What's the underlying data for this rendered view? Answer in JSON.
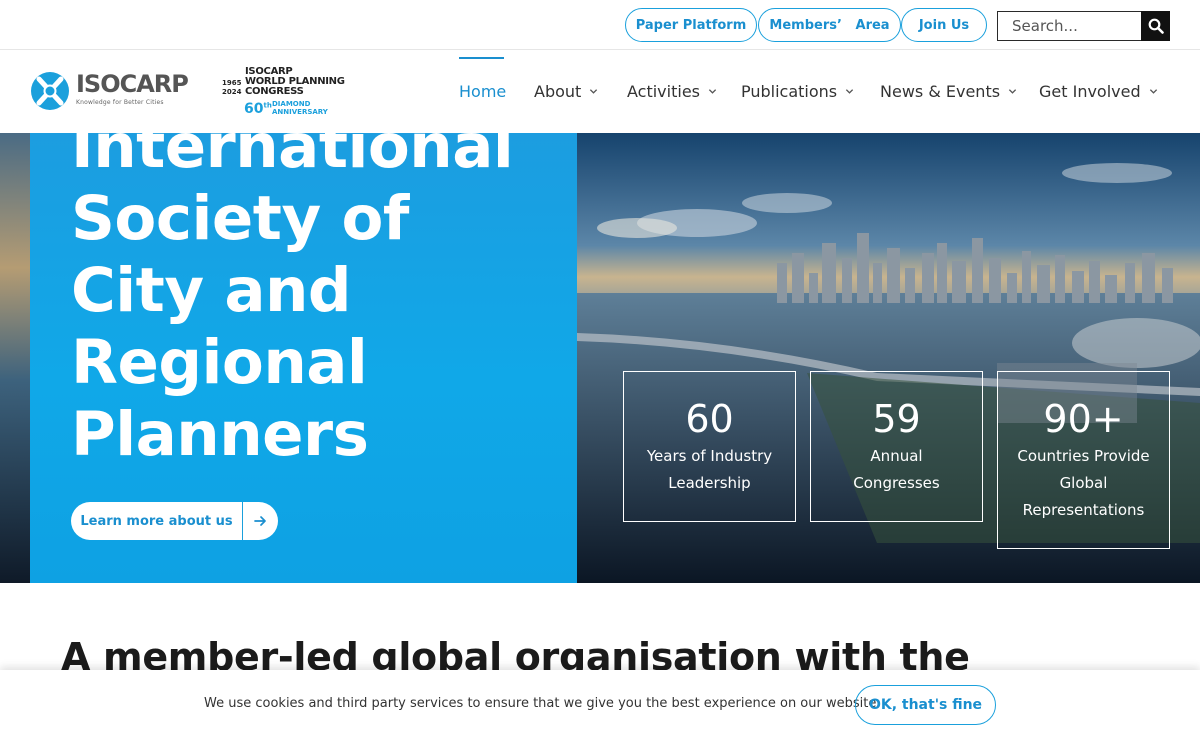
{
  "topbar": {
    "paper_platform": "Paper Platform",
    "members_area": "Members’   Area",
    "join_us": "Join Us",
    "search_placeholder": "Search..."
  },
  "logo": {
    "name": "ISOCARP",
    "tagline": "Knowledge for Better Cities"
  },
  "anniversary": {
    "year_start": "1965",
    "year_end": "2024",
    "title_line1": "ISOCARP",
    "title_line2": "WORLD PLANNING",
    "title_line3": "CONGRESS",
    "number": "60",
    "ordinal": "th",
    "sub_line1": "DIAMOND",
    "sub_line2": "ANNIVERSARY"
  },
  "nav": {
    "items": [
      {
        "label": "Home",
        "active": true
      },
      {
        "label": "About"
      },
      {
        "label": "Activities"
      },
      {
        "label": "Publications"
      },
      {
        "label": "News & Events"
      },
      {
        "label": "Get Involved"
      }
    ]
  },
  "hero": {
    "title_line1": "International",
    "title_line2": "Society of",
    "title_line3": "City and",
    "title_line4": "Regional",
    "title_line5": "Planners",
    "cta": "Learn more about us",
    "stats": [
      {
        "number": "60",
        "label_line1": "Years of Industry",
        "label_line2": "Leadership",
        "label_line3": ""
      },
      {
        "number": "59",
        "label_line1": "Annual",
        "label_line2": "Congresses",
        "label_line3": ""
      },
      {
        "number": "90+",
        "label_line1": "Countries Provide",
        "label_line2": "Global",
        "label_line3": "Representations"
      }
    ]
  },
  "section": {
    "heading": "A member-led global organisation with the"
  },
  "cookie": {
    "text": "We use cookies and third party services to ensure that we give you the best experience on our website.",
    "button": "OK, that's fine"
  },
  "colors": {
    "accent": "#1a8fcf",
    "hero_panel": "#10a8e8",
    "text_dark": "#1b1b1b"
  }
}
